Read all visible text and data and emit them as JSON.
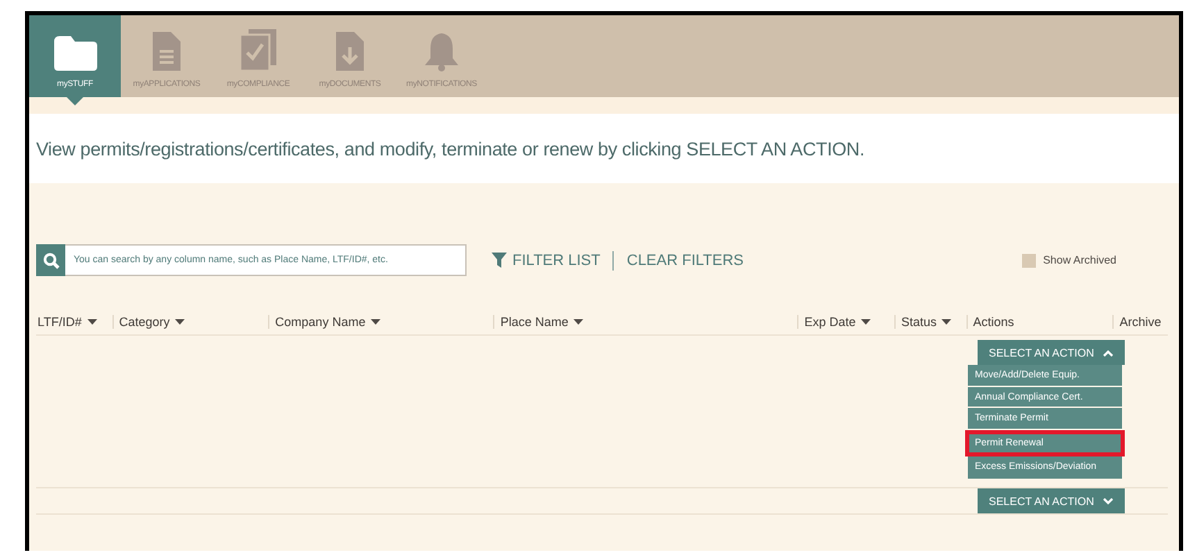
{
  "nav": {
    "tabs": [
      {
        "label": "mySTUFF",
        "kind": "folder",
        "selected": true
      },
      {
        "label": "myAPPLICATIONS",
        "kind": "document",
        "selected": false
      },
      {
        "label": "myCOMPLIANCE",
        "kind": "checklist",
        "selected": false
      },
      {
        "label": "myDOCUMENTS",
        "kind": "download",
        "selected": false
      },
      {
        "label": "myNOTIFICATIONS",
        "kind": "bell",
        "selected": false
      }
    ]
  },
  "intro": "View permits/registrations/certificates, and modify, terminate or renew by clicking SELECT AN ACTION.",
  "toolbar": {
    "search": {
      "placeholder": "You can search by any column name, such as Place Name, LTF/ID#, etc."
    },
    "filter_button": "FILTER LIST",
    "clear_filters": "CLEAR FILTERS",
    "show_archived": {
      "label": "Show Archived",
      "checked": false
    }
  },
  "table": {
    "columns": [
      {
        "label": "LTF/ID#",
        "sortable": true
      },
      {
        "label": "Category",
        "sortable": true
      },
      {
        "label": "Company Name",
        "sortable": true
      },
      {
        "label": "Place Name",
        "sortable": true
      },
      {
        "label": "Exp Date",
        "sortable": true
      },
      {
        "label": "Status",
        "sortable": true
      },
      {
        "label": "Actions",
        "sortable": false
      },
      {
        "label": "Archive",
        "sortable": false
      }
    ],
    "rows": [
      {
        "action_button": {
          "label": "SELECT AN ACTION",
          "expanded": true
        }
      },
      {
        "action_button": {
          "label": "SELECT AN ACTION",
          "expanded": false
        }
      }
    ]
  },
  "action_menu": {
    "items": [
      {
        "label": "Move/Add/Delete Equip.",
        "highlighted": false
      },
      {
        "label": "Annual Compliance Cert.",
        "highlighted": false
      },
      {
        "label": "Terminate Permit",
        "highlighted": false
      },
      {
        "label": "Permit Renewal",
        "highlighted": true
      },
      {
        "label": "Excess Emissions/Deviation",
        "highlighted": false
      }
    ]
  }
}
